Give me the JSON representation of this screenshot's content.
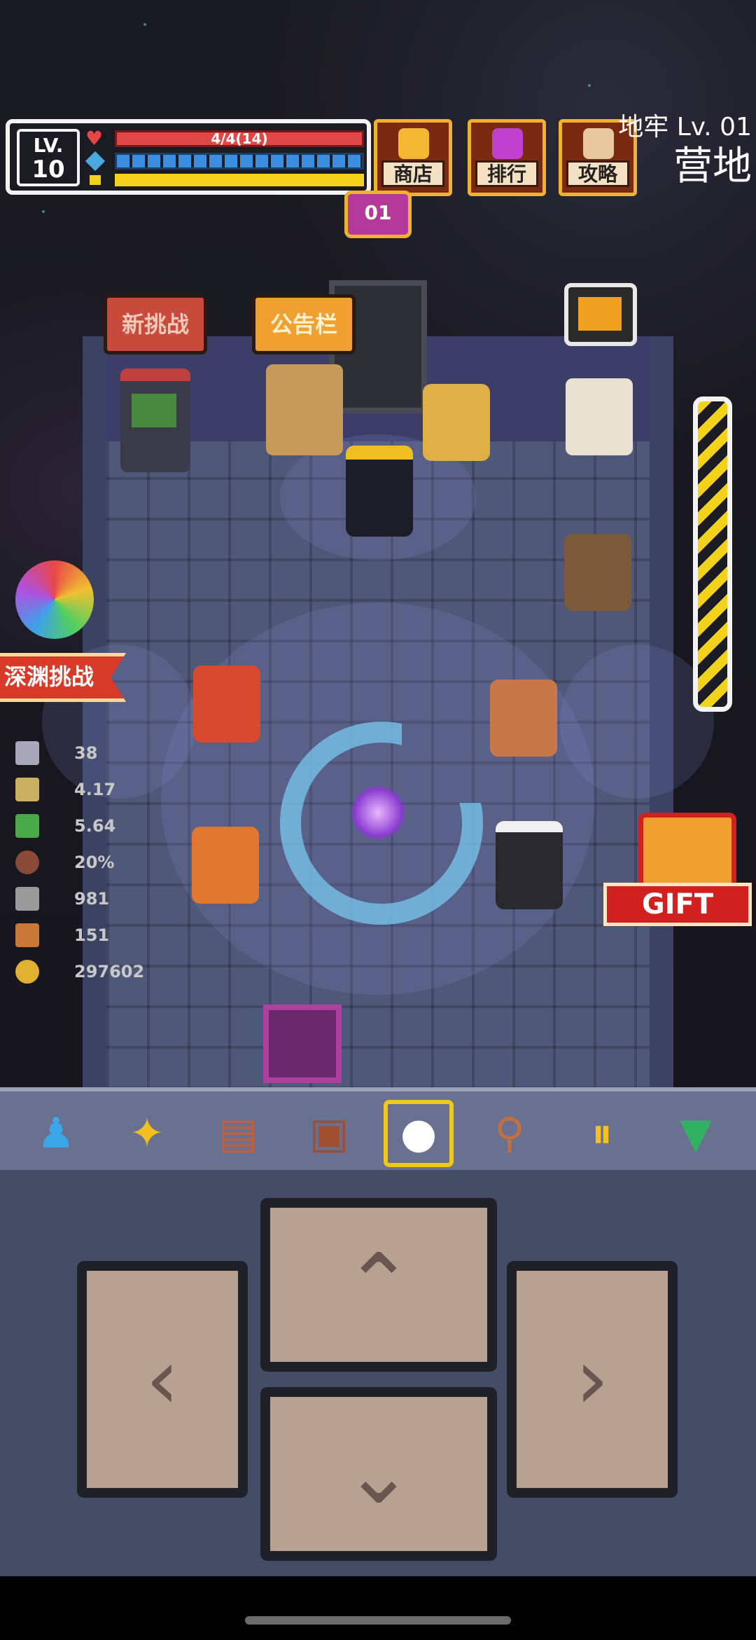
{
  "hud": {
    "level_label": "LV.",
    "level_value": "10",
    "hp_text": "4/4(14)",
    "hp_fraction": 1.0,
    "mp_fraction": 1.0,
    "xp_fraction": 1.0
  },
  "top_buttons": [
    {
      "label": "商店",
      "icon": "shop-bag-icon",
      "color": "#f2b830"
    },
    {
      "label": "排行",
      "icon": "trophy-icon",
      "color": "#c040d0"
    },
    {
      "label": "攻略",
      "icon": "guide-board-icon",
      "color": "#e8c8a0"
    }
  ],
  "floor": {
    "title": "地牢 Lv. 01",
    "name": "营地",
    "badge": "01"
  },
  "signs": {
    "new_challenge": "新挑战",
    "bulletin": "公告栏"
  },
  "abyss_label": "深渊挑战",
  "stats": [
    {
      "icon": "sword-icon",
      "value": "38",
      "color": "#a8a8b8"
    },
    {
      "icon": "crit-sword-icon",
      "value": "4.17",
      "color": "#c8b060"
    },
    {
      "icon": "boot-icon",
      "value": "5.64",
      "color": "#4aa84a"
    },
    {
      "icon": "shield-icon",
      "value": "20%",
      "color": "#8a4a3a"
    },
    {
      "icon": "silver-key-icon",
      "value": "981",
      "color": "#9a9a9a"
    },
    {
      "icon": "bronze-key-icon",
      "value": "151",
      "color": "#c87838"
    },
    {
      "icon": "gold-coin-icon",
      "value": "297602",
      "color": "#e0b030"
    }
  ],
  "gift_label": "GIFT",
  "toolbar": [
    {
      "name": "character",
      "icon": "character-icon",
      "glyph": "♟",
      "color": "#3aa8e8"
    },
    {
      "name": "skills",
      "icon": "sparkle-icon",
      "glyph": "✦",
      "color": "#f2c020"
    },
    {
      "name": "book",
      "icon": "book-icon",
      "glyph": "▤",
      "color": "#c06040"
    },
    {
      "name": "bag",
      "icon": "bag-icon",
      "glyph": "▣",
      "color": "#a05030"
    },
    {
      "name": "center",
      "icon": "target-icon",
      "glyph": "●",
      "color": "#ffffff",
      "selected": true
    },
    {
      "name": "search",
      "icon": "magnifier-icon",
      "glyph": "⚲",
      "color": "#c07040"
    },
    {
      "name": "pause",
      "icon": "pause-icon",
      "glyph": "⏸",
      "color": "#f2c020"
    },
    {
      "name": "collapse",
      "icon": "chevron-down-icon",
      "glyph": "▼",
      "color": "#30b060"
    }
  ],
  "controls": {
    "up": "⌃",
    "down": "⌄",
    "left": "‹",
    "right": "›"
  }
}
